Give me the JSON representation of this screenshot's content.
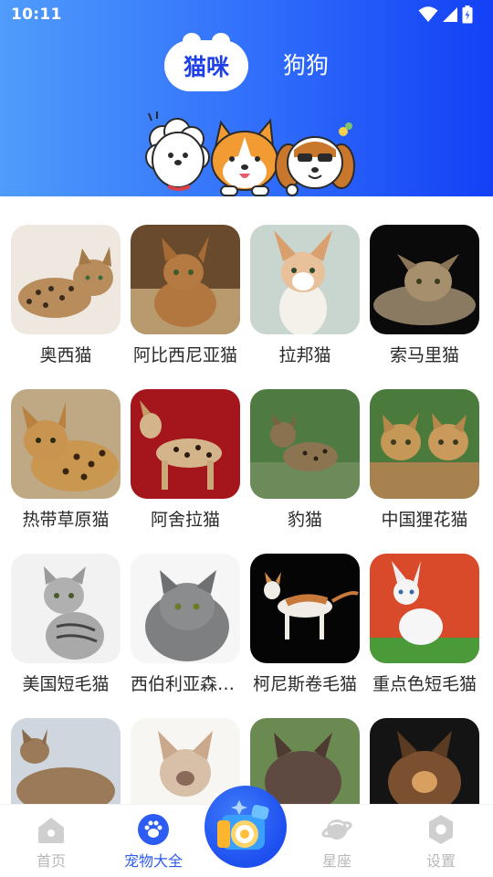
{
  "status_bar": {
    "time": "10:11"
  },
  "tabs": {
    "cat": "猫咪",
    "dog": "狗狗"
  },
  "breeds": [
    {
      "name": "奥西猫"
    },
    {
      "name": "阿比西尼亚猫"
    },
    {
      "name": "拉邦猫"
    },
    {
      "name": "索马里猫"
    },
    {
      "name": "热带草原猫"
    },
    {
      "name": "阿舍拉猫"
    },
    {
      "name": "豹猫"
    },
    {
      "name": "中国狸花猫"
    },
    {
      "name": "美国短毛猫"
    },
    {
      "name": "西伯利亚森林猫"
    },
    {
      "name": "柯尼斯卷毛猫"
    },
    {
      "name": "重点色短毛猫"
    },
    {
      "name": ""
    },
    {
      "name": ""
    },
    {
      "name": ""
    },
    {
      "name": ""
    }
  ],
  "bottom_nav": {
    "home": "首页",
    "pets": "宠物大全",
    "zodiac": "星座",
    "settings": "设置"
  },
  "colors": {
    "accent": "#2d5cf2",
    "header_start": "#4f9cfb",
    "header_end": "#1340f5",
    "inactive": "#b8b8b8"
  },
  "icons": {
    "home": "home-icon",
    "pets": "paw-icon",
    "center": "camera-icon",
    "zodiac": "planet-icon",
    "settings": "gear-icon"
  }
}
